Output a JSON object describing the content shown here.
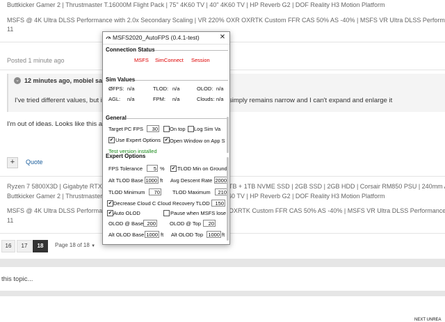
{
  "forum": {
    "sig_top_1": "Buttkicker Gamer 2 | Thrustmaster T.16000M Flight Pack | 75\" 4K60 TV | 40\" 4K60 TV | HP Reverb G2 | DOF Reality H3 Motion Platform",
    "sig_top_2": "MSFS @ 4K Ultra DLSS Performance with 2.0x Secondary Scaling |  VR 220% OXR OXRTK Custom FFR CAS 50% AS -40% | MSFS VR Ultra DLSS Performance - W",
    "sig_top_3": "11",
    "posted": "Posted 1 minute ago",
    "quote_header": "12 minutes ago, mobiel said:",
    "quote_text": "I've tried different values, but it",
    "quote_text_right": "simply remains narrow and I can't expand and enlarge it",
    "post_body": "I'm out of ideas. Looks like this ap",
    "plus": "+",
    "quote_link": "Quote",
    "sig2_1": "Ryzen 7 5800X3D | Gigabyte RTX 4",
    "sig2_1_right": "TB + 1TB NVME SSD | 2GB SSD | 2GB HDD | Corsair RM850 PSU | 240mm AIO",
    "sig2_2": "Buttkicker Gamer 2 | Thrustmaster T.16000M Flight Pack | 75\" 4K60 TV | 40\" 4K60 TV | HP Reverb G2 | DOF Reality H3 Motion Platform",
    "sig2_3": "MSFS @ 4K Ultra DLSS Performanc",
    "sig2_3_right": "OXRTK Custom FFR CAS 50% AS -40% | MSFS VR Ultra DLSS Performance - W",
    "sig2_4": "11",
    "pages": [
      "16",
      "17",
      "18"
    ],
    "page_of": "Page 18 of 18",
    "reply_placeholder": "this topic...",
    "footer_partial": "NEXT UNREA"
  },
  "dialog": {
    "title": "MSFS2020_AutoFPS (0.4.1-test)",
    "close": "✕",
    "connection": {
      "label": "Connection Status",
      "items": [
        "MSFS",
        "SimConnect",
        "Session"
      ]
    },
    "sim_values": {
      "label": "Sim Values",
      "fps_label": "ØFPS:",
      "fps": "n/a",
      "tlod_label": "TLOD:",
      "tlod": "n/a",
      "olod_label": "OLOD:",
      "olod": "n/a",
      "agl_label": "AGL:",
      "agl": "n/a",
      "fpm_label": "FPM:",
      "fpm": "n/a",
      "clouds_label": "Clouds:",
      "clouds": "n/a"
    },
    "general": {
      "label": "General",
      "target_fps_label": "Target PC FPS",
      "target_fps": "30",
      "on_top": "On top",
      "log_sim": "Log Sim Va",
      "use_expert": "Use Expert Options",
      "open_window": "Open Window on App S",
      "test_version": "Test version installed"
    },
    "expert": {
      "label": "Expert Options",
      "fps_tol_label": "FPS Tolerance",
      "fps_tol": "5",
      "fps_tol_unit": "%",
      "tlod_min_ground": "TLOD Min on Ground/",
      "alt_tlod_base_label": "Alt TLOD Base",
      "alt_tlod_base": "1000",
      "ft1": "ft",
      "avg_descent_label": "Avg Descent Rate",
      "avg_descent": "2000",
      "tlod_min_label": "TLOD Minimum",
      "tlod_min": "70",
      "tlod_max_label": "TLOD Maximum",
      "tlod_max": "210",
      "decrease_cloud": "Decrease Cloud C Cloud Recovery TLOD",
      "cloud_recovery": "150",
      "auto_olod": "Auto OLOD",
      "pause_msfs": "Pause when MSFS lose",
      "olod_base_label": "OLOD @ Base",
      "olod_base": "200",
      "olod_top_label": "OLOD @ Top",
      "olod_top": "20",
      "alt_olod_base_label": "Alt OLOD Base",
      "alt_olod_base": "1000",
      "ft2": "ft",
      "alt_olod_top_label": "Alt OLOD Top",
      "alt_olod_top": "1000",
      "ft3": "ft"
    },
    "checked": "✔"
  }
}
